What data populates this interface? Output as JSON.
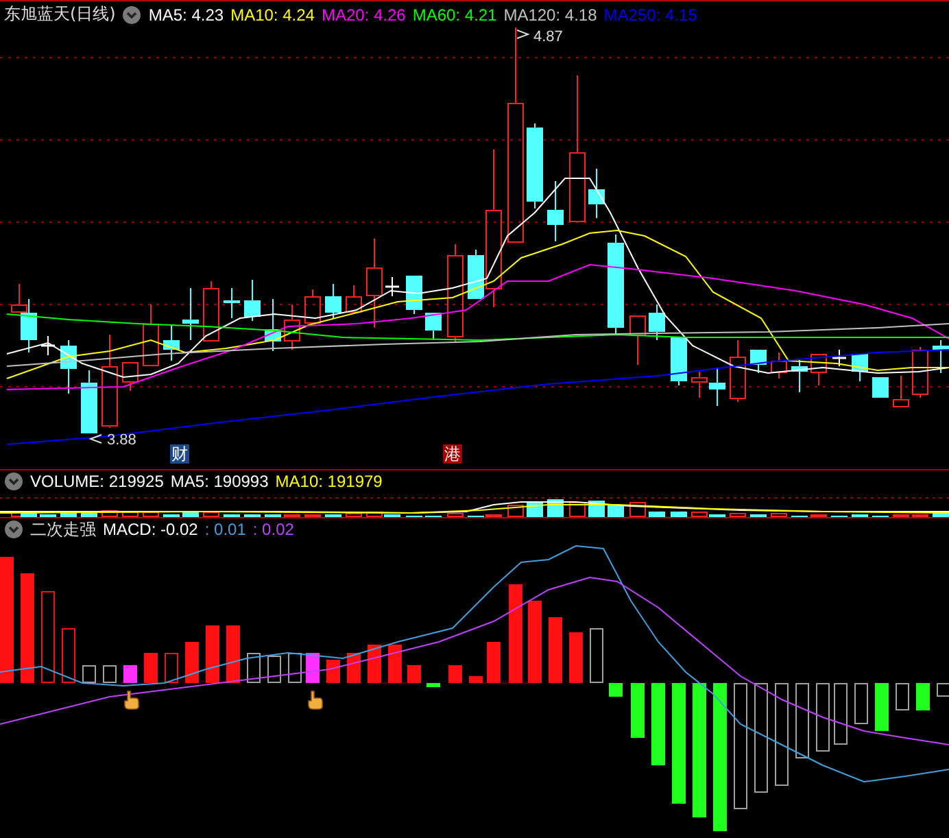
{
  "main": {
    "title": "东旭蓝天(日线)",
    "moving_averages": [
      {
        "label": "MA5:",
        "value": "4.23",
        "color": "#ffffff"
      },
      {
        "label": "MA10:",
        "value": "4.24",
        "color": "#ffff00"
      },
      {
        "label": "MA20:",
        "value": "4.26",
        "color": "#ff00ff"
      },
      {
        "label": "MA60:",
        "value": "4.21",
        "color": "#00ff00"
      },
      {
        "label": "MA120:",
        "value": "4.18",
        "color": "#c0c0c0"
      },
      {
        "label": "MA250:",
        "value": "4.15",
        "color": "#0000ff"
      }
    ],
    "high_label": "4.87",
    "low_label": "3.88",
    "event_tags": [
      {
        "label": "财",
        "color": "#1c4a8c"
      },
      {
        "label": "港",
        "color": "#a80000"
      }
    ]
  },
  "volume": {
    "items": [
      {
        "label": "VOLUME:",
        "value": "219925",
        "color": "#ffffff"
      },
      {
        "label": "MA5:",
        "value": "190993",
        "color": "#ffffff"
      },
      {
        "label": "MA10:",
        "value": "191979",
        "color": "#ffff00"
      }
    ]
  },
  "macd": {
    "title": "二次走强",
    "items": [
      {
        "label": "MACD:",
        "value": "-0.02",
        "color": "#ffffff"
      },
      {
        "label": ":",
        "value": "0.01",
        "color": "#3fa0e0"
      },
      {
        "label": ":",
        "value": "0.02",
        "color": "#c040ff"
      }
    ]
  }
}
